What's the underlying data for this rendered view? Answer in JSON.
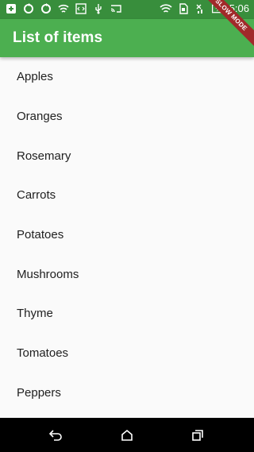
{
  "status_bar": {
    "time": "5:06",
    "left_icons": [
      "add-box-icon",
      "sync-icon",
      "sync-icon",
      "wifi-icon",
      "code-icon",
      "usb-icon",
      "cast-icon"
    ],
    "right_icons": [
      "wifi-icon",
      "sim-icon",
      "no-signal-icon",
      "battery-charging-icon"
    ]
  },
  "app_bar": {
    "title": "List of items"
  },
  "debug_banner": {
    "label": "SLOW MODE"
  },
  "list": {
    "items": [
      "Apples",
      "Oranges",
      "Rosemary",
      "Carrots",
      "Potatoes",
      "Mushrooms",
      "Thyme",
      "Tomatoes",
      "Peppers"
    ]
  },
  "nav_bar": {
    "buttons": [
      "back-icon",
      "home-icon",
      "recents-icon"
    ]
  },
  "colors": {
    "app_bar": "#4caf50",
    "status_bar": "#388e3c",
    "background": "#fafafa",
    "nav_bar": "#000000",
    "banner": "#a12a2a"
  }
}
